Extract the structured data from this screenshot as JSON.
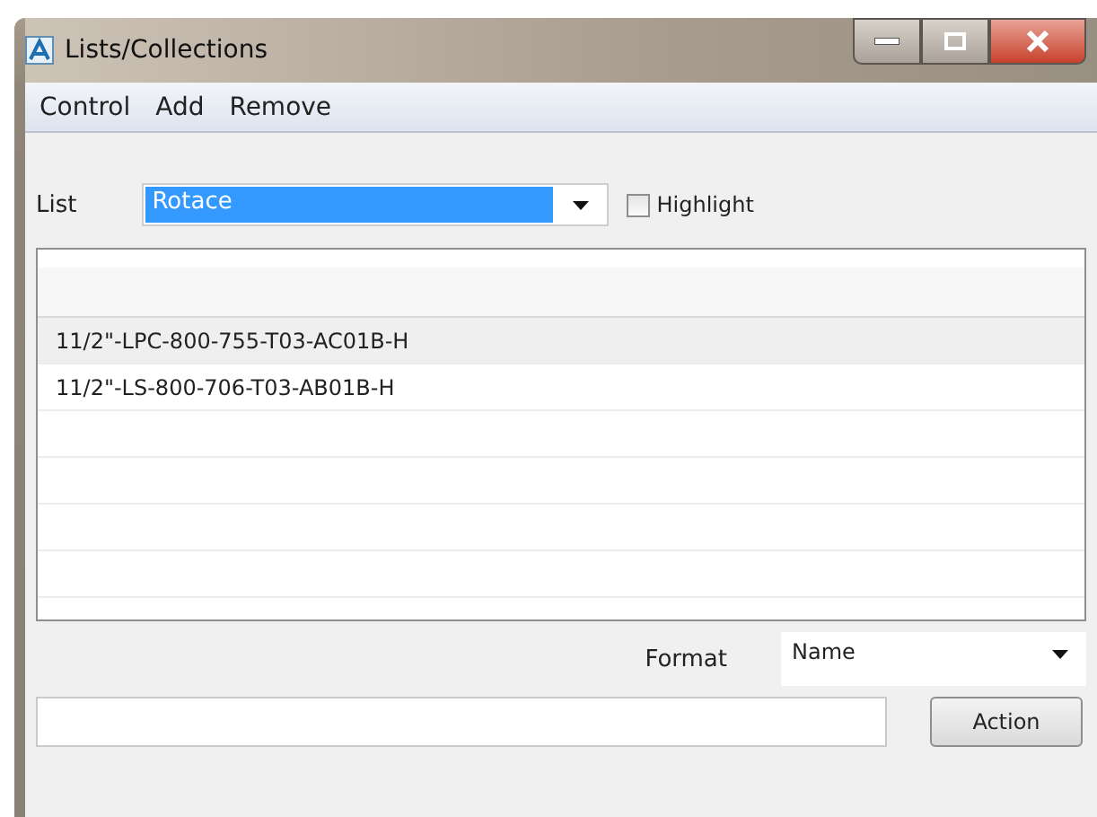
{
  "window": {
    "title": "Lists/Collections"
  },
  "menu": [
    "Control",
    "Add",
    "Remove"
  ],
  "list_selector": {
    "label": "List",
    "value": "Rotace",
    "highlight": {
      "label": "Highlight",
      "checked": false
    }
  },
  "items": [
    {
      "text": "11/2\"-LPC-800-755-T03-AC01B-H",
      "selected": true
    },
    {
      "text": "11/2\"-LS-800-706-T03-AB01B-H",
      "selected": false
    }
  ],
  "format": {
    "label": "Format",
    "value": "Name"
  },
  "action_button": "Action"
}
